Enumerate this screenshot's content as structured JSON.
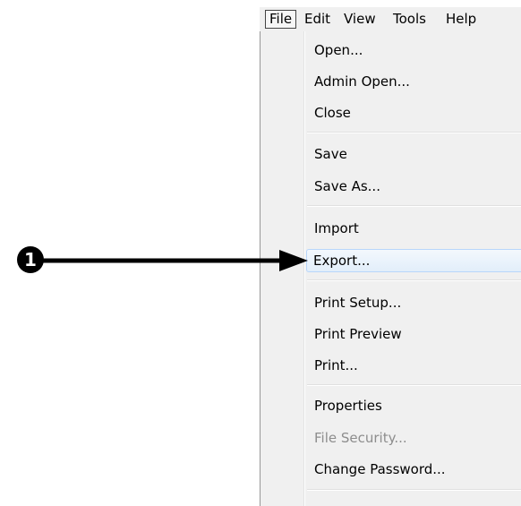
{
  "menubar": {
    "items": [
      "File",
      "Edit",
      "View",
      "Tools",
      "Help"
    ],
    "active": "File"
  },
  "file_menu": {
    "items": [
      {
        "label": "Open...",
        "enabled": true
      },
      {
        "label": "Admin Open...",
        "enabled": true
      },
      {
        "label": "Close",
        "enabled": true
      },
      {
        "label": "Save",
        "enabled": true
      },
      {
        "label": "Save As...",
        "enabled": true
      },
      {
        "label": "Import",
        "enabled": true
      },
      {
        "label": "Export...",
        "enabled": true,
        "highlighted": true
      },
      {
        "label": "Print Setup...",
        "enabled": true
      },
      {
        "label": "Print Preview",
        "enabled": true
      },
      {
        "label": "Print...",
        "enabled": true
      },
      {
        "label": "Properties",
        "enabled": true
      },
      {
        "label": "File Security...",
        "enabled": false
      },
      {
        "label": "Change Password...",
        "enabled": true
      }
    ]
  },
  "callout": {
    "number": "1",
    "points_to": "Export..."
  },
  "colors": {
    "menu_background": "#f0f0f0",
    "highlight_border": "#b8d6fb",
    "disabled_text": "#8d8d8d",
    "callout": "#000000"
  }
}
